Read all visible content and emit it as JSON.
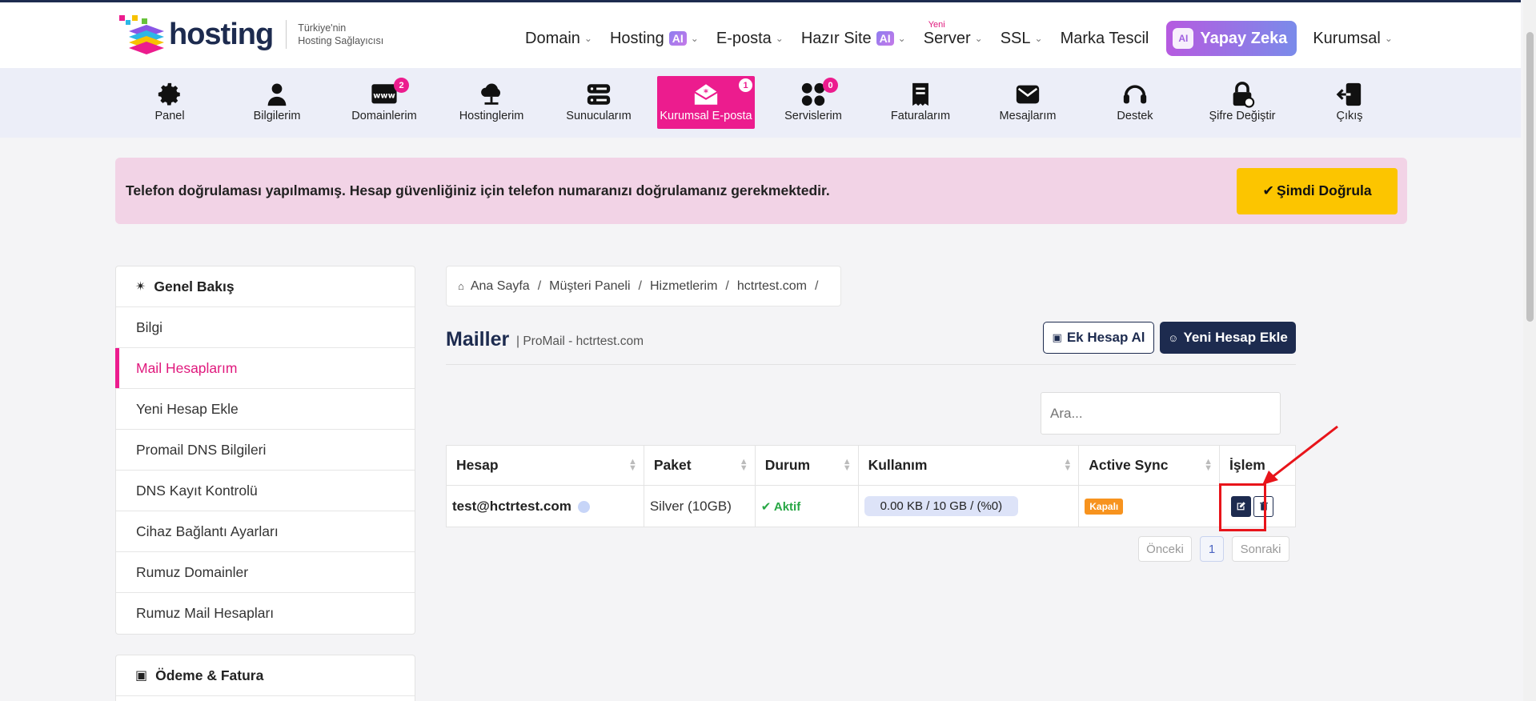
{
  "header": {
    "logo_text": "hosting",
    "tagline": [
      "Türkiye'nin",
      "Hosting Sağlayıcısı"
    ],
    "nav": [
      {
        "label": "Domain"
      },
      {
        "label": "Hosting",
        "badge": "AI"
      },
      {
        "label": "E-posta"
      },
      {
        "label": "Hazır Site",
        "badge": "AI"
      },
      {
        "label": "Server",
        "tag": "Yeni"
      },
      {
        "label": "SSL"
      },
      {
        "label": "Marka Tescil"
      },
      {
        "label": "Yapay Zeka",
        "icon_text": "AI"
      },
      {
        "label": "Kurumsal"
      }
    ]
  },
  "iconbar": [
    {
      "label": "Panel",
      "icon": "gear-icon"
    },
    {
      "label": "Bilgilerim",
      "icon": "user-icon"
    },
    {
      "label": "Domainlerim",
      "icon": "www-icon",
      "count": "2"
    },
    {
      "label": "Hostinglerim",
      "icon": "cloud-icon"
    },
    {
      "label": "Sunucularım",
      "icon": "server-icon"
    },
    {
      "label": "Kurumsal E-posta",
      "icon": "mail-open-icon",
      "count": "1",
      "active": true
    },
    {
      "label": "Servislerim",
      "icon": "grid-icon",
      "count": "0"
    },
    {
      "label": "Faturalarım",
      "icon": "invoice-icon"
    },
    {
      "label": "Mesajlarım",
      "icon": "envelope-icon"
    },
    {
      "label": "Destek",
      "icon": "headset-icon"
    },
    {
      "label": "Şifre Değiştir",
      "icon": "lock-icon"
    },
    {
      "label": "Çıkış",
      "icon": "logout-icon"
    }
  ],
  "alert": {
    "text": "Telefon doğrulaması yapılmamış. Hesap güvenliğiniz için telefon numaranızı doğrulamanız gerekmektedir.",
    "button": "Şimdi Doğrula"
  },
  "sidebar": {
    "overview_title": "Genel Bakış",
    "items": [
      "Bilgi",
      "Mail Hesaplarım",
      "Yeni Hesap Ekle",
      "Promail DNS Bilgileri",
      "DNS Kayıt Kontrolü",
      "Cihaz Bağlantı Ayarları",
      "Rumuz Domainler",
      "Rumuz Mail Hesapları"
    ],
    "active_item": "Mail Hesaplarım",
    "billing_title": "Ödeme & Fatura"
  },
  "breadcrumb": [
    "Ana Sayfa",
    "Müşteri Paneli",
    "Hizmetlerim",
    "hctrtest.com"
  ],
  "page": {
    "title": "Mailler",
    "subtitle": "| ProMail - hctrtest.com",
    "btn_extra": "Ek Hesap Al",
    "btn_new": "Yeni Hesap Ekle",
    "search_placeholder": "Ara..."
  },
  "table": {
    "columns": [
      "Hesap",
      "Paket",
      "Durum",
      "Kullanım",
      "Active Sync",
      "İşlem"
    ],
    "rows": [
      {
        "account": "test@hctrtest.com",
        "package": "Silver (10GB)",
        "status": "Aktif",
        "usage": "0.00 KB / 10 GB / (%0)",
        "active_sync": "Kapalı"
      }
    ]
  },
  "pagination": {
    "prev": "Önceki",
    "page": "1",
    "next": "Sonraki"
  },
  "colors": {
    "brand_dark": "#1d2b4f",
    "accent_pink": "#ec1c8e",
    "alert_bg": "#f2d3e6",
    "cta_yellow": "#fcc500",
    "highlight_red": "#e8141a"
  }
}
